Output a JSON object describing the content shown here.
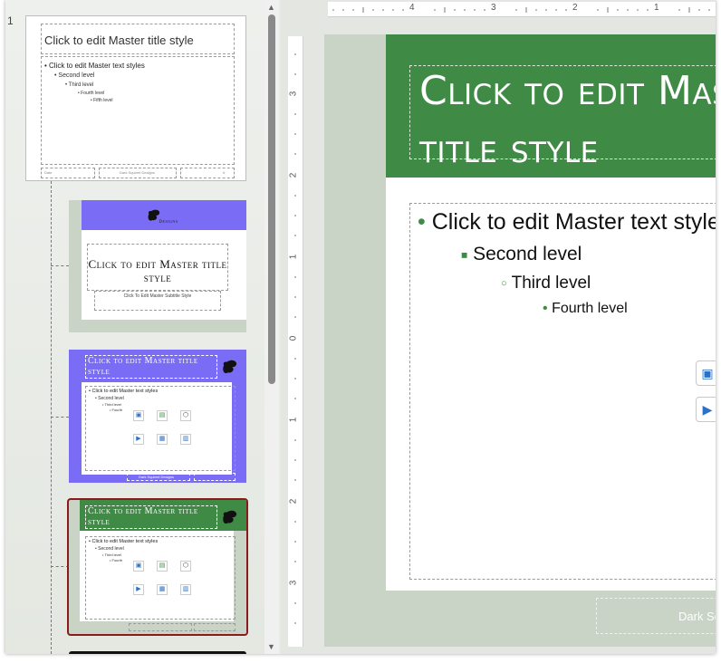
{
  "slide_number": "1",
  "master": {
    "title": "Click to edit Master title style",
    "levels": [
      "Click to edit Master text styles",
      "Second level",
      "Third level",
      "Fourth level",
      "Fifth level"
    ],
    "footer_left": "Date",
    "footer_center": "Dark Squirrel Designs",
    "footer_right": "#"
  },
  "layout1": {
    "logo_text": "Designs",
    "title": "Click to edit Master title style",
    "subtitle": "Click To Edit Master Subtitle Style"
  },
  "layout2": {
    "title": "Click to edit Master title style",
    "levels": [
      "Click to edit Master text styles",
      "Second level",
      "Third level",
      "Fourth"
    ],
    "footer_center": "Dark Squirrel Designs",
    "color": "#7b6cf6"
  },
  "layout3": {
    "title": "Click to edit Master title style",
    "levels": [
      "Click to edit Master text styles",
      "Second level",
      "Third level",
      "Fourth"
    ],
    "color": "#3f8a45",
    "selected_border": "#8b1a1a"
  },
  "ruler": {
    "h_numbers": [
      "4",
      "3",
      "2",
      "1"
    ],
    "v_numbers": [
      "3",
      "2",
      "1",
      "0",
      "1",
      "2",
      "3"
    ]
  },
  "editor": {
    "title": "Click to edit Master title style",
    "level1": "Click to edit Master text styles",
    "level2": "Second level",
    "level3": "Third level",
    "level4": "Fourth level",
    "footer": "Dark Squirrel Designs",
    "accent": "#3f8a45"
  }
}
